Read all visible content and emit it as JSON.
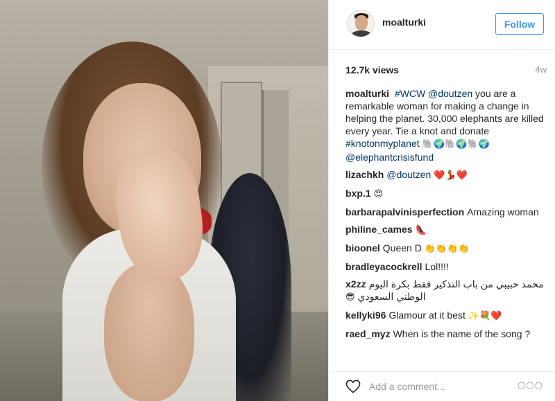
{
  "post": {
    "username": "moalturki",
    "follow_label": "Follow",
    "views": "12.7k views",
    "age": "4w"
  },
  "caption": {
    "author": "moalturki",
    "parts": [
      {
        "text": "#WCW",
        "kind": "link"
      },
      {
        "text": " ",
        "kind": "text"
      },
      {
        "text": "@doutzen",
        "kind": "link"
      },
      {
        "text": " you are a remarkable woman for making a change in helping the planet. 30,000 elephants are killed every year. Tie a knot and donate ",
        "kind": "text"
      },
      {
        "text": "#knotonmyplanet",
        "kind": "link"
      },
      {
        "text": " 🐘🌍🐘🌍🐘🌍",
        "kind": "emoji"
      },
      {
        "text": "\n",
        "kind": "break"
      },
      {
        "text": "@elephantcrisisfund",
        "kind": "link"
      }
    ]
  },
  "comments": [
    {
      "author": "lizachkh",
      "parts": [
        {
          "text": "@doutzen",
          "kind": "link"
        },
        {
          "text": " ❤️💃❤️",
          "kind": "emoji"
        }
      ]
    },
    {
      "author": "bxp.1",
      "parts": [
        {
          "text": "😍",
          "kind": "emoji"
        }
      ]
    },
    {
      "author": "barbarapalvinisperfection",
      "parts": [
        {
          "text": "Amazing woman",
          "kind": "text"
        }
      ]
    },
    {
      "author": "philine_cames",
      "parts": [
        {
          "text": "👠",
          "kind": "emoji"
        }
      ]
    },
    {
      "author": "bioonel",
      "parts": [
        {
          "text": "Queen D ",
          "kind": "text"
        },
        {
          "text": "👏👏👏👏",
          "kind": "emoji"
        }
      ]
    },
    {
      "author": "bradleyacockrell",
      "parts": [
        {
          "text": "Lol!!!!",
          "kind": "text"
        }
      ]
    },
    {
      "author": "x2zz",
      "rtl": true,
      "parts": [
        {
          "text": "محمد حبيبي من باب التذكير فقط بكرة اليوم الوطني السعودي ",
          "kind": "text"
        },
        {
          "text": "😎",
          "kind": "emoji"
        }
      ]
    },
    {
      "author": "kellyki96",
      "parts": [
        {
          "text": "Glamour at it best ",
          "kind": "text"
        },
        {
          "text": "✨💐❤️",
          "kind": "emoji"
        }
      ]
    },
    {
      "author": "raed_myz",
      "parts": [
        {
          "text": "When is the name of the song ?",
          "kind": "text"
        }
      ]
    }
  ],
  "footer": {
    "comment_placeholder": "Add a comment...",
    "more_label": "○○○"
  },
  "icons": {
    "like": "heart-icon",
    "more": "more-options-icon"
  },
  "colors": {
    "link": "#003569",
    "follow": "#3897f0",
    "muted": "#999999"
  }
}
